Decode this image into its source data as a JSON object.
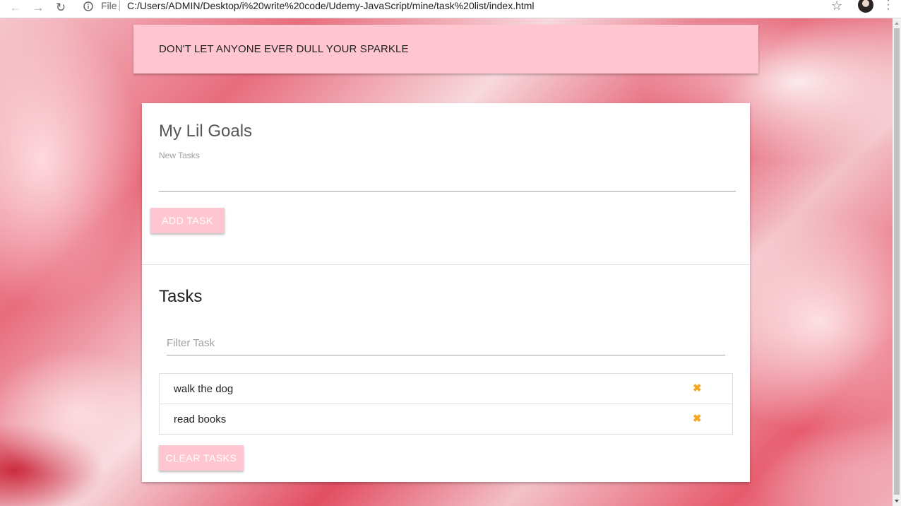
{
  "browser": {
    "scheme_label": "File",
    "url": "C:/Users/ADMIN/Desktop/i%20write%20code/Udemy-JavaScript/mine/task%20list/index.html",
    "icons": [
      "back-arrow-icon",
      "forward-arrow-icon",
      "reload-icon",
      "info-icon",
      "star-icon",
      "avatar",
      "menu-icon"
    ]
  },
  "quote": {
    "text": "DON'T LET ANYONE EVER DULL YOUR SPARKLE"
  },
  "card": {
    "title": "My Lil Goals",
    "new_task_label": "New Tasks",
    "new_task_value": "",
    "add_button": "ADD TASK",
    "tasks_title": "Tasks",
    "filter_placeholder": "Filter Task",
    "tasks": [
      {
        "text": "walk the dog"
      },
      {
        "text": "read books"
      }
    ],
    "clear_button": "CLEAR TASKS"
  },
  "colors": {
    "banner_bg": "#ffc6d1",
    "button_bg": "#ffc6d1",
    "delete_icon": "#f5a623",
    "card_bg": "#ffffff"
  }
}
